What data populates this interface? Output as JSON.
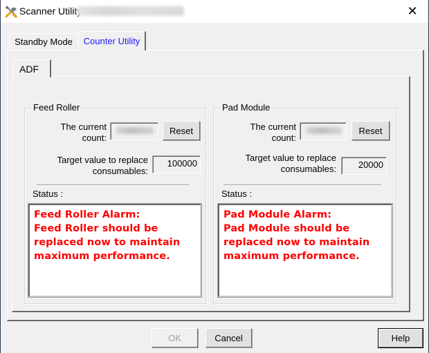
{
  "window": {
    "title": "Scanner Utility",
    "title_redacted": true,
    "close_label": "✕"
  },
  "tabs": [
    {
      "label": "Standby Mode",
      "active": false
    },
    {
      "label": "Counter Utility",
      "active": true
    }
  ],
  "subtabs": [
    {
      "label": "ADF",
      "active": true
    }
  ],
  "feed_roller": {
    "group_label": "Feed Roller",
    "current_count_label": "The current\ncount:",
    "current_count_value": "",
    "reset_label": "Reset",
    "target_label": "Target value to replace\nconsumables:",
    "target_value": "100000",
    "status_label": "Status :",
    "status_text": "Feed Roller Alarm:\nFeed Roller should be\nreplaced now to maintain\nmaximum performance."
  },
  "pad_module": {
    "group_label": "Pad Module",
    "current_count_label": "The current\ncount:",
    "current_count_value": "",
    "reset_label": "Reset",
    "target_label": "Target value to replace\nconsumables:",
    "target_value": "20000",
    "status_label": "Status :",
    "status_text": "Pad Module Alarm:\nPad Module should be\nreplaced now to maintain\nmaximum performance."
  },
  "footer": {
    "ok_label": "OK",
    "ok_enabled": false,
    "cancel_label": "Cancel",
    "help_label": "Help"
  },
  "colors": {
    "alarm_text": "#ff0000",
    "active_tab_text": "#1a1aff"
  }
}
